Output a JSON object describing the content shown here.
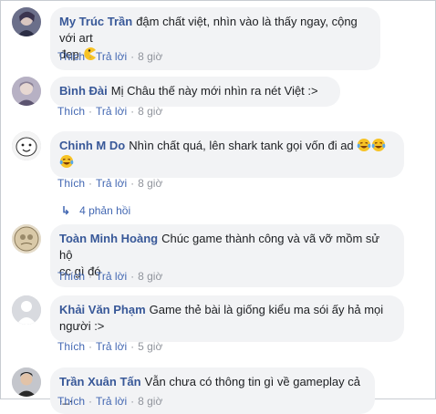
{
  "comments": [
    {
      "name": "My Trúc Trần",
      "text": "đậm chất việt, nhìn vào là thấy ngay, cộng với art",
      "text2": "đẹp",
      "emoji": "pacman-emoji",
      "like": "Thích",
      "reply": "Trả lời",
      "time": "8 giờ"
    },
    {
      "name": "Bình Đài",
      "text": "Mị Châu thế này mới nhìn ra nét Việt :>",
      "like": "Thích",
      "reply": "Trả lời",
      "time": "8 giờ"
    },
    {
      "name": "Chinh M Do",
      "text": "Nhìn chất quá, lên shark tank gọi vốn đi ad",
      "emoji": "laughing-tears-emoji",
      "like": "Thích",
      "reply": "Trả lời",
      "time": "8 giờ",
      "replies_label": "4 phản hồi"
    },
    {
      "name": "Toàn Minh Hoàng",
      "text": "Chúc game thành công và vã vỡ mồm sử hộ",
      "text2": "cc gì đó",
      "like": "Thích",
      "reply": "Trả lời",
      "time": "8 giờ"
    },
    {
      "name": "Khải Văn Phạm",
      "text": "Game thẻ bài là giống kiểu ma sói ấy hả mọi",
      "text2": "người :>",
      "like": "Thích",
      "reply": "Trả lời",
      "time": "5 giờ"
    },
    {
      "name": "Trần Xuân Tấn",
      "text": "Vẫn chưa có thông tin gì về gameplay cả ._.",
      "like": "Thích",
      "reply": "Trả lời",
      "time": "8 giờ"
    }
  ],
  "colors": {
    "name": "#385898",
    "bubble": "#f2f3f5",
    "link": "#4267b2",
    "meta": "#90949c"
  }
}
